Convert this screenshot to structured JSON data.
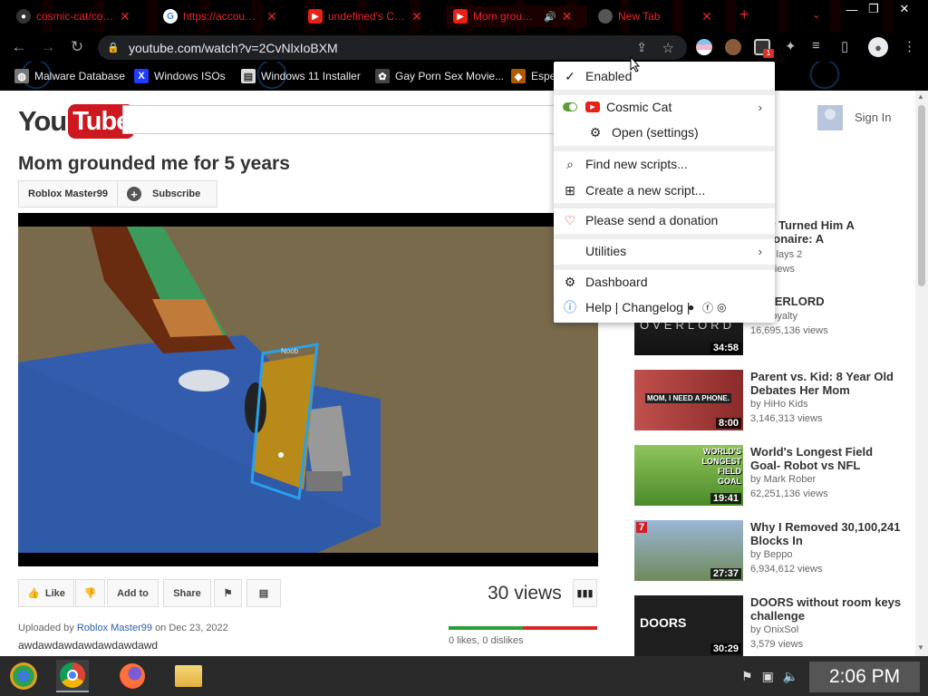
{
  "browser": {
    "tabs": [
      {
        "title": "cosmic-cat/cosmi",
        "icon": "github-icon"
      },
      {
        "title": "https://accounts.",
        "icon": "google-icon"
      },
      {
        "title": "undefined's Cha",
        "icon": "youtube-icon"
      },
      {
        "title": "Mom grounde",
        "icon": "youtube-icon"
      },
      {
        "title": "New Tab",
        "icon": "chrome-icon"
      }
    ],
    "new_tab": "+",
    "url": "youtube.com/watch?v=2CvNlxIoBXM",
    "bookmarks": [
      {
        "label": "Malware Database"
      },
      {
        "label": "Windows ISOs"
      },
      {
        "label": "Windows 11 Installer"
      },
      {
        "label": "Gay Porn Sex Movie..."
      },
      {
        "label": "Espe"
      }
    ],
    "extension_badge": "1"
  },
  "youtube": {
    "logo_you": "You",
    "logo_tube": "Tube",
    "sign_in": "Sign In",
    "video_title": "Mom grounded me for 5 years",
    "channel": "Roblox Master99",
    "subscribe": "Subscribe",
    "player_name_tag": "Noob",
    "actions": {
      "like": "Like",
      "add_to": "Add to",
      "share": "Share"
    },
    "views": "30 views",
    "uploaded_prefix": "Uploaded by",
    "uploader": "Roblox Master99",
    "uploaded_date": "on Dec 23, 2022",
    "description": "awdawdawdawdawdawdawd",
    "likes_text": "0 likes, 0 dislikes",
    "like_ratio": 0.5,
    "recommendations": [
      {
        "title": "ollar Turned Him A Millionaire: A",
        "by": "aneP lays 2",
        "views": "465 views",
        "duration": ""
      },
      {
        "title": ": OVERLORD",
        "by": "an Royalty",
        "views": "16,695,136 views",
        "duration": "34:58"
      },
      {
        "title": "Parent vs. Kid: 8 Year Old Debates Her Mom",
        "by": "by HiHo Kids",
        "views": "3,146,313 views",
        "duration": "8:00"
      },
      {
        "title": "World's Longest Field Goal- Robot vs NFL",
        "by": "by Mark Rober",
        "views": "62,251,136 views",
        "duration": "19:41"
      },
      {
        "title": "Why I Removed 30,100,241 Blocks In",
        "by": "by Beppo",
        "views": "6,934,612 views",
        "duration": "27:37"
      },
      {
        "title": "DOORS without room keys challenge",
        "by": "by OnixSol",
        "views": "3,579 views",
        "duration": "30:29"
      }
    ],
    "thumb_text": {
      "overlord": "OVERLORD",
      "phone": "MOM, I NEED A PHONE.",
      "field_goal": "WORLD'S LONGEST FIELD GOAL",
      "doors": "DOORS",
      "seven": "7"
    }
  },
  "popup": {
    "enabled": "Enabled",
    "script_name": "Cosmic Cat",
    "open_settings": "Open (settings)",
    "find_scripts": "Find new scripts...",
    "create_script": "Create a new script...",
    "donation": "Please send a donation",
    "utilities": "Utilities",
    "dashboard": "Dashboard",
    "help": "Help | Changelog |"
  },
  "taskbar": {
    "clock": "2:06 PM"
  },
  "colors": {
    "tab_text": "#e6252e",
    "yt_red": "#cc181e",
    "like_green": "#2a9d36",
    "dislike_red": "#e02424",
    "link_blue": "#2a5db0"
  }
}
